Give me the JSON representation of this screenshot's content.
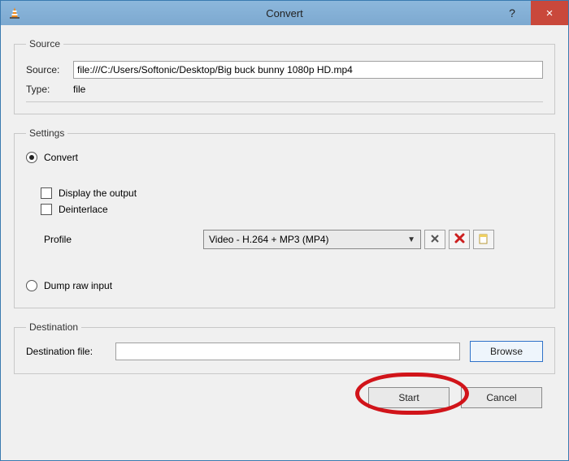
{
  "window": {
    "title": "Convert",
    "help_tooltip": "?",
    "close_tooltip": "×"
  },
  "source": {
    "legend": "Source",
    "source_label": "Source:",
    "source_value": "file:///C:/Users/Softonic/Desktop/Big buck bunny 1080p HD.mp4",
    "type_label": "Type:",
    "type_value": "file"
  },
  "settings": {
    "legend": "Settings",
    "convert_label": "Convert",
    "display_label": "Display the output",
    "deinterlace_label": "Deinterlace",
    "profile_label": "Profile",
    "profile_value": "Video - H.264 + MP3 (MP4)",
    "dump_label": "Dump raw input"
  },
  "destination": {
    "legend": "Destination",
    "dest_label": "Destination file:",
    "dest_value": "",
    "browse_label": "Browse"
  },
  "footer": {
    "start_label": "Start",
    "cancel_label": "Cancel"
  },
  "icons": {
    "tools": "tools-icon",
    "delete": "delete-icon",
    "new_profile": "new-profile-icon"
  }
}
